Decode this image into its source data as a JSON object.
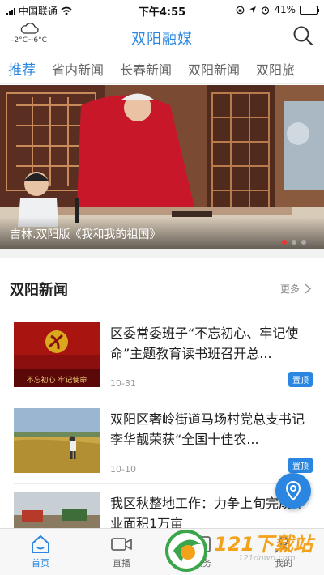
{
  "status_bar": {
    "carrier": "中国联通",
    "time": "下午4:55",
    "battery": "41%",
    "battery_level": 0.41
  },
  "header": {
    "title": "双阳融媒",
    "temperature": "-2°C~6°C"
  },
  "tabs": [
    {
      "label": "推荐",
      "active": true
    },
    {
      "label": "省内新闻",
      "active": false
    },
    {
      "label": "长春新闻",
      "active": false
    },
    {
      "label": "双阳新闻",
      "active": false
    },
    {
      "label": "双阳旅",
      "active": false
    }
  ],
  "banner": {
    "caption": "吉林.双阳版《我和我的祖国》",
    "slide_count": 3,
    "current_slide": 1
  },
  "section": {
    "title": "双阳新闻",
    "more_label": "更多"
  },
  "news": [
    {
      "headline": "区委常委班子“不忘初心、牢记使命”主题教育读书班召开总...",
      "date": "10-31",
      "badge": "置顶",
      "thumb_text": "不忘初心 牢记使命"
    },
    {
      "headline": "双阳区奢岭街道马场村党总支书记李华靓荣获“全国十佳农...",
      "date": "10-10",
      "badge": "置顶"
    },
    {
      "headline": "我区秋整地工作：力争上旬完成作业面积1万亩"
    }
  ],
  "bottom_nav": [
    {
      "label": "首页",
      "active": true
    },
    {
      "label": "直播",
      "active": false
    },
    {
      "label": "服务",
      "active": false
    },
    {
      "label": "我的",
      "active": false
    }
  ],
  "watermark": {
    "text": "121下载站",
    "url": "121down.com"
  },
  "colors": {
    "accent": "#2a86e0",
    "active_dot": "#e33333",
    "badge": "#2a86e0"
  }
}
